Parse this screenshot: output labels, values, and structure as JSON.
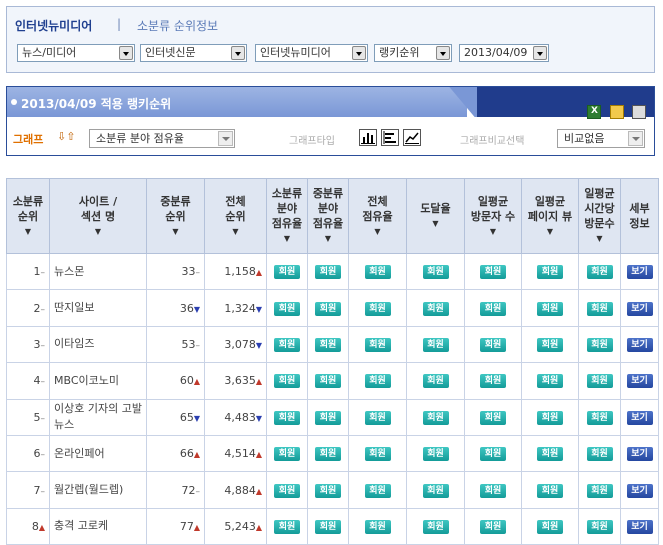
{
  "header": {
    "title": "인터넷뉴미디어",
    "separator": "|",
    "subtitle": "소분류 순위정보"
  },
  "filters": [
    "뉴스/미디어",
    "인터넷신문",
    "인터넷뉴미디어",
    "랭키순위",
    "2013/04/09"
  ],
  "ranking_box": {
    "title": "2013/04/09 적용 랭키순위",
    "graph_label": "그래프",
    "graph_select": "소분류 분야 점유율",
    "graph_type_label": "그래프타입",
    "graph_compare_label": "그래프비교선택",
    "compare_select": "비교없음",
    "toolbar_icons": [
      "excel-icon",
      "copy-icon",
      "print-icon"
    ]
  },
  "table": {
    "columns": [
      [
        "소분류",
        "순위"
      ],
      [
        "사이트 /",
        "섹션 명"
      ],
      [
        "중분류",
        "순위"
      ],
      [
        "전체",
        "순위"
      ],
      [
        "소분류",
        "분야",
        "점유율"
      ],
      [
        "중분류",
        "분야",
        "점유율"
      ],
      [
        "전체",
        "점유율"
      ],
      [
        "도달율"
      ],
      [
        "일평균",
        "방문자 수"
      ],
      [
        "일평균",
        "페이지 뷰"
      ],
      [
        "일평균",
        "시간당",
        "방문수"
      ],
      [
        "세부",
        "정보"
      ]
    ],
    "member_label": "회원",
    "view_label": "보기",
    "rows": [
      {
        "rank": "1",
        "rank_change": "same",
        "site": "뉴스몬",
        "mid_rank": "33",
        "mid_change": "same",
        "total_rank": "1,158",
        "total_change": "up"
      },
      {
        "rank": "2",
        "rank_change": "same",
        "site": "딴지일보",
        "mid_rank": "36",
        "mid_change": "down",
        "total_rank": "1,324",
        "total_change": "down"
      },
      {
        "rank": "3",
        "rank_change": "same",
        "site": "이타임즈",
        "mid_rank": "53",
        "mid_change": "same",
        "total_rank": "3,078",
        "total_change": "down"
      },
      {
        "rank": "4",
        "rank_change": "same",
        "site": "MBC이코노미",
        "mid_rank": "60",
        "mid_change": "up",
        "total_rank": "3,635",
        "total_change": "up"
      },
      {
        "rank": "5",
        "rank_change": "same",
        "site": "이상호 기자의 고발뉴스",
        "mid_rank": "65",
        "mid_change": "down",
        "total_rank": "4,483",
        "total_change": "down"
      },
      {
        "rank": "6",
        "rank_change": "same",
        "site": "온라인페어",
        "mid_rank": "66",
        "mid_change": "up",
        "total_rank": "4,514",
        "total_change": "up"
      },
      {
        "rank": "7",
        "rank_change": "same",
        "site": "월간렙(월드렙)",
        "mid_rank": "72",
        "mid_change": "same",
        "total_rank": "4,884",
        "total_change": "up"
      },
      {
        "rank": "8",
        "rank_change": "up",
        "site": "충격 고로케",
        "mid_rank": "77",
        "mid_change": "up",
        "total_rank": "5,243",
        "total_change": "up"
      }
    ]
  }
}
